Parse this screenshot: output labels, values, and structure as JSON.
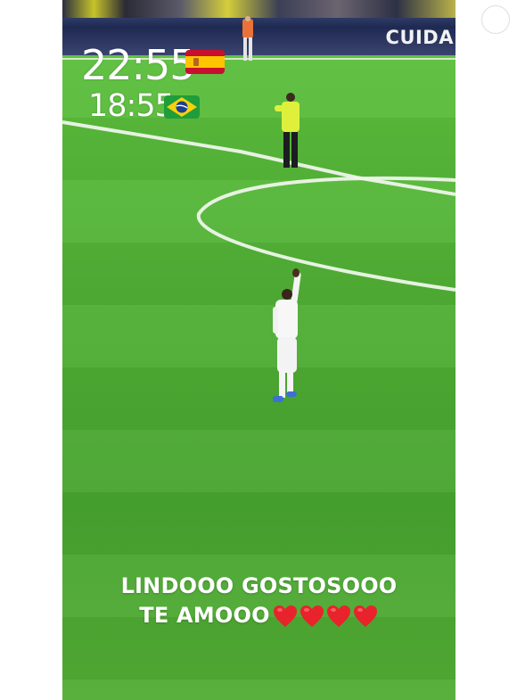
{
  "overlay": {
    "time_spain": "22:55",
    "time_brazil": "18:55",
    "flag_spain": "spain-flag",
    "flag_brazil": "brazil-flag"
  },
  "adboard": {
    "text": "CUIDA"
  },
  "caption": {
    "line1": "LINDOOO GOSTOSOOO",
    "line2": "TE AMOOO",
    "hearts": "❤️❤️❤️❤️",
    "heart_color": "#e8232b"
  },
  "colors": {
    "pitch": "#4fae34",
    "steward_vest": "#d8f03a",
    "kit": "#ffffff"
  }
}
